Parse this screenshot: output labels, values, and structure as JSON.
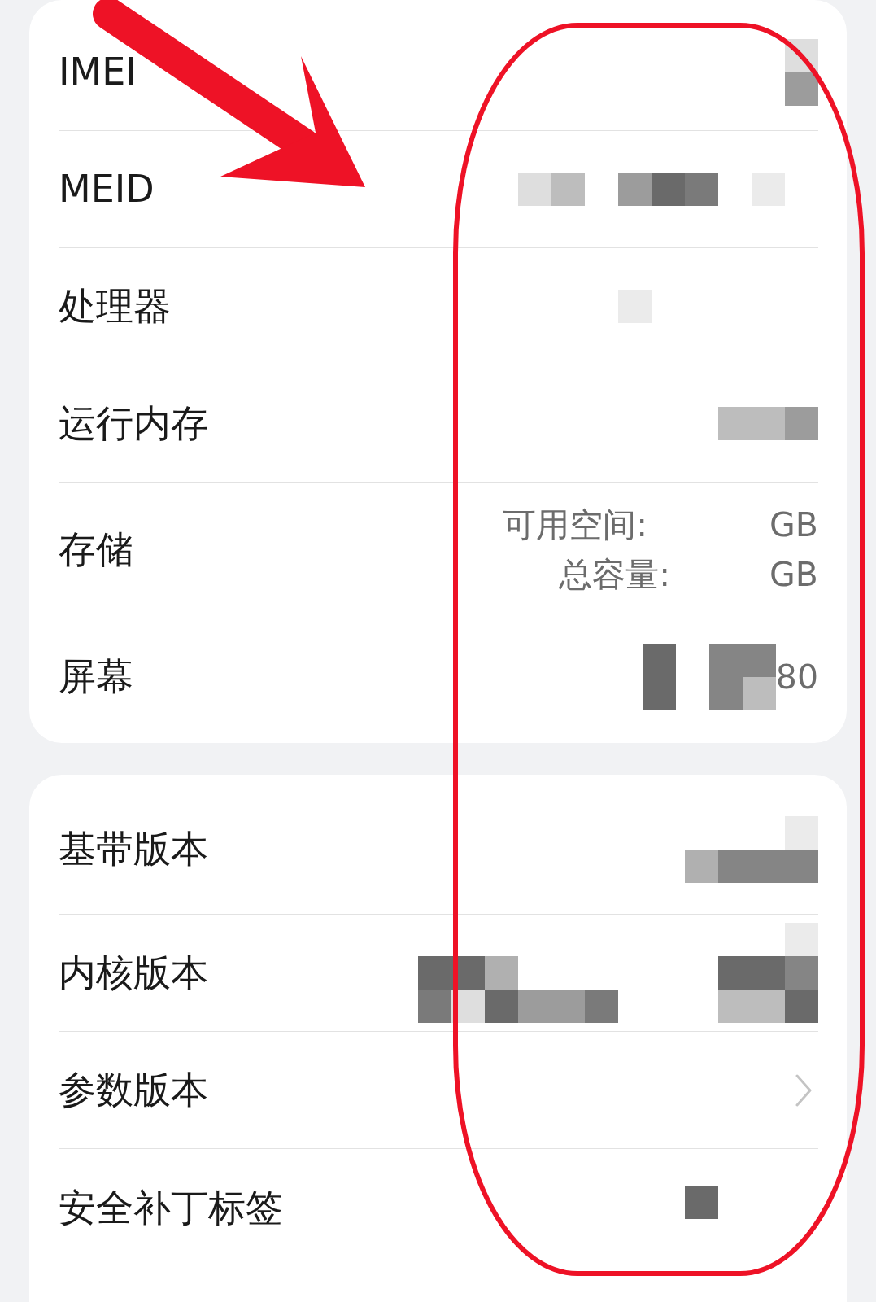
{
  "cards": [
    {
      "rows": [
        {
          "kind": "info",
          "label": "IMEI",
          "redacted": true
        },
        {
          "kind": "info",
          "label": "MEID",
          "redacted": true
        },
        {
          "kind": "info",
          "label": "处理器",
          "redacted": true
        },
        {
          "kind": "info",
          "label": "运行内存",
          "redacted": true
        },
        {
          "kind": "storage",
          "label": "存储",
          "lines": [
            {
              "label": "可用空间:",
              "value": "GB"
            },
            {
              "label": "总容量:",
              "value": "GB"
            }
          ]
        },
        {
          "kind": "info",
          "label": "屏幕",
          "redacted": true,
          "value": "80"
        }
      ]
    },
    {
      "rows": [
        {
          "kind": "info",
          "label": "基带版本",
          "redacted": true
        },
        {
          "kind": "info",
          "label": "内核版本",
          "redacted": true
        },
        {
          "kind": "link",
          "label": "参数版本"
        },
        {
          "kind": "info",
          "label": "安全补丁标签",
          "redacted": true
        }
      ]
    }
  ],
  "annotations": {
    "arrow": true,
    "outline": true
  }
}
